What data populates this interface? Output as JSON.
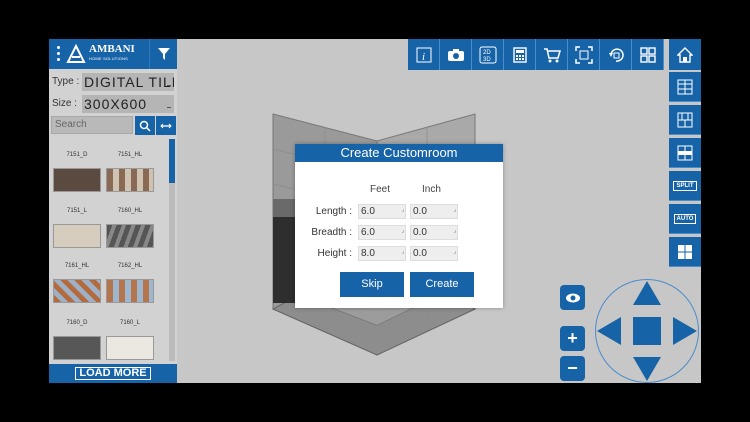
{
  "brand": {
    "name": "AMBANI",
    "tagline": "HOME SOLUTIONS"
  },
  "panel": {
    "type_label": "Type :",
    "type_value": "DIGITAL TILE",
    "size_label": "Size :",
    "size_value": "300X600",
    "search_placeholder": "Search",
    "load_more": "LOAD MORE",
    "tiles": [
      {
        "label": "7151_D"
      },
      {
        "label": "7151_HL"
      },
      {
        "label": "7151_L"
      },
      {
        "label": "7160_HL"
      },
      {
        "label": "7161_HL"
      },
      {
        "label": "7162_HL"
      },
      {
        "label": "7160_D"
      },
      {
        "label": "7160_L"
      }
    ]
  },
  "toolbar": {
    "info_icon": "info-icon",
    "camera_icon": "camera-icon",
    "view_toggle": "2D 3D",
    "calculator_icon": "calculator-icon",
    "cart_icon": "cart-icon",
    "expand_icon": "expand-icon",
    "rotate_icon": "rotate-icon",
    "grid_icon": "grid-icon",
    "home_icon": "home-icon"
  },
  "side_toolbar": {
    "split_label": "SPLIT",
    "auto_label": "AUTO"
  },
  "modal": {
    "title": "Create Customroom",
    "col_feet": "Feet",
    "col_inch": "Inch",
    "fields": [
      {
        "label": "Length :",
        "feet": "6.0",
        "inch": "0.0"
      },
      {
        "label": "Breadth :",
        "feet": "6.0",
        "inch": "0.0"
      },
      {
        "label": "Height :",
        "feet": "8.0",
        "inch": "0.0"
      }
    ],
    "skip": "Skip",
    "create": "Create"
  },
  "controls": {
    "plus": "+",
    "minus": "−"
  },
  "colors": {
    "primary": "#1763a8",
    "background": "#c7c7c7",
    "panel": "#d2d2d2"
  }
}
